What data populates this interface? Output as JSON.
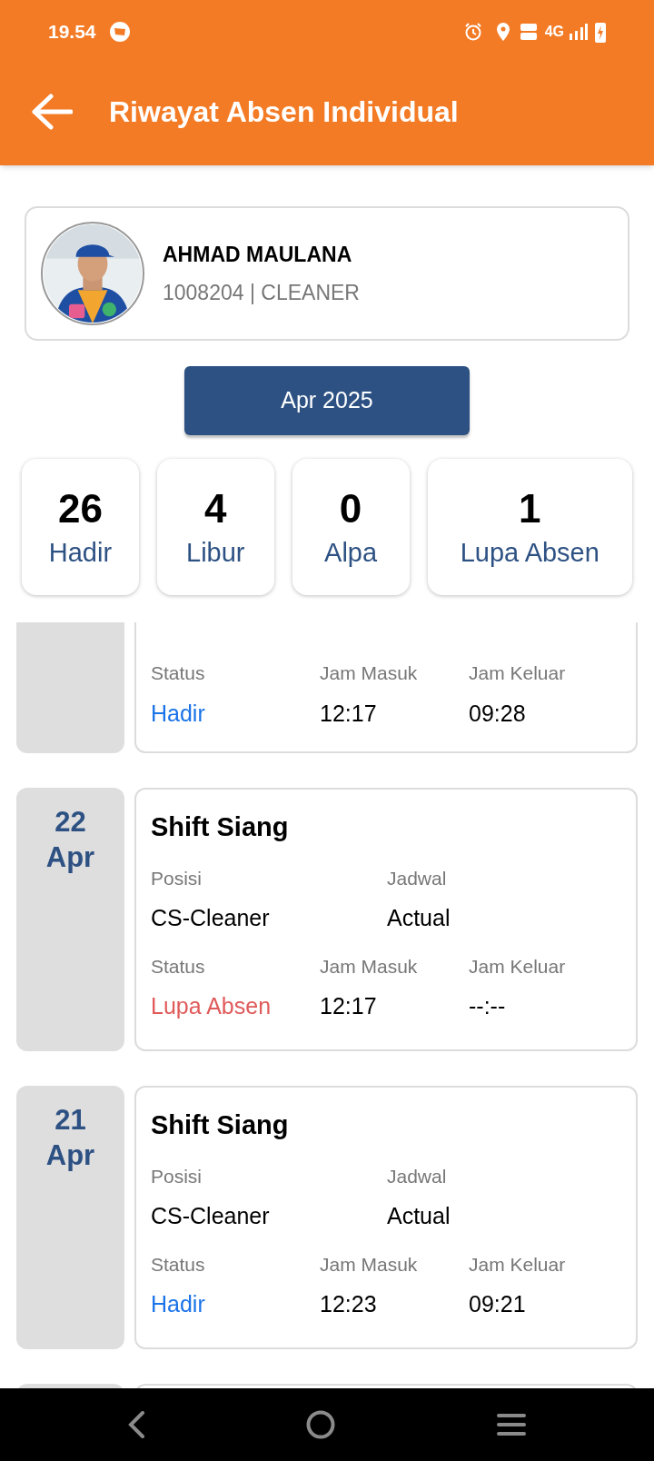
{
  "status_bar": {
    "time": "19.54",
    "network": "4G"
  },
  "app_bar": {
    "title": "Riwayat Absen Individual"
  },
  "profile": {
    "name": "AHMAD MAULANA",
    "details": "1008204 | CLEANER"
  },
  "month_button": "Apr 2025",
  "stats": [
    {
      "value": "26",
      "label": "Hadir"
    },
    {
      "value": "4",
      "label": "Libur"
    },
    {
      "value": "0",
      "label": "Alpa"
    },
    {
      "value": "1",
      "label": "Lupa Absen"
    }
  ],
  "records": [
    {
      "kind": "partial",
      "status_label": "Status",
      "status": "Hadir",
      "color": "#1a73e8",
      "in_label": "Jam Masuk",
      "in": "12:17",
      "out_label": "Jam Keluar",
      "out": "09:28"
    },
    {
      "kind": "full",
      "day": "22",
      "month": "Apr",
      "shift": "Shift Siang",
      "position_label": "Posisi",
      "position": "CS-Cleaner",
      "schedule_label": "Jadwal",
      "schedule": "Actual",
      "status_label": "Status",
      "status": "Lupa Absen",
      "color": "#e05a5a",
      "in_label": "Jam Masuk",
      "in": "12:17",
      "out_label": "Jam Keluar",
      "out": "--:--"
    },
    {
      "kind": "full",
      "day": "21",
      "month": "Apr",
      "shift": "Shift Siang",
      "position_label": "Posisi",
      "position": "CS-Cleaner",
      "schedule_label": "Jadwal",
      "schedule": "Actual",
      "status_label": "Status",
      "status": "Hadir",
      "color": "#1a73e8",
      "in_label": "Jam Masuk",
      "in": "12:23",
      "out_label": "Jam Keluar",
      "out": "09:21"
    },
    {
      "kind": "edge"
    }
  ]
}
